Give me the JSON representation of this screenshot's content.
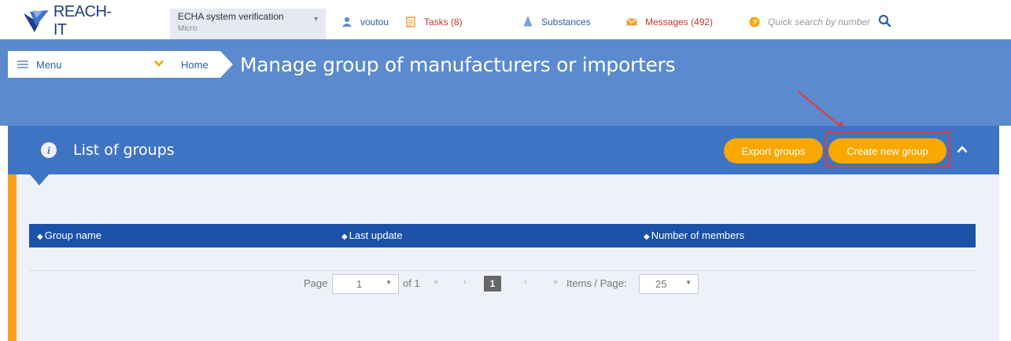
{
  "app": {
    "logo_text": "REACH-IT"
  },
  "legal_entity": {
    "name": "ECHA system verification",
    "size": "Micro"
  },
  "nav": {
    "user": "voutou",
    "tasks": "Tasks (8)",
    "substances": "Substances",
    "messages": "Messages (492)",
    "search_placeholder": "Quick search by number"
  },
  "menu": {
    "label": "Menu"
  },
  "breadcrumb": {
    "home": "Home"
  },
  "page": {
    "title": "Manage group of manufacturers or importers"
  },
  "panel": {
    "title": "List of groups",
    "export_label": "Export groups",
    "create_label": "Create new group"
  },
  "table": {
    "columns": [
      "Group name",
      "Last update",
      "Number of members"
    ],
    "rows": []
  },
  "pagination": {
    "page_label": "Page",
    "current_page": "1",
    "of_label": "of 1",
    "first": "«",
    "prev": "‹",
    "next": "›",
    "last": "»",
    "items_label": "Items / Page:",
    "items_per_page": "25"
  },
  "colors": {
    "brand_blue": "#1b52a8",
    "header_blue": "#5b8ace",
    "panel_blue": "#3f74c4",
    "accent_orange": "#f8a800",
    "alert_red": "#c0392b"
  }
}
